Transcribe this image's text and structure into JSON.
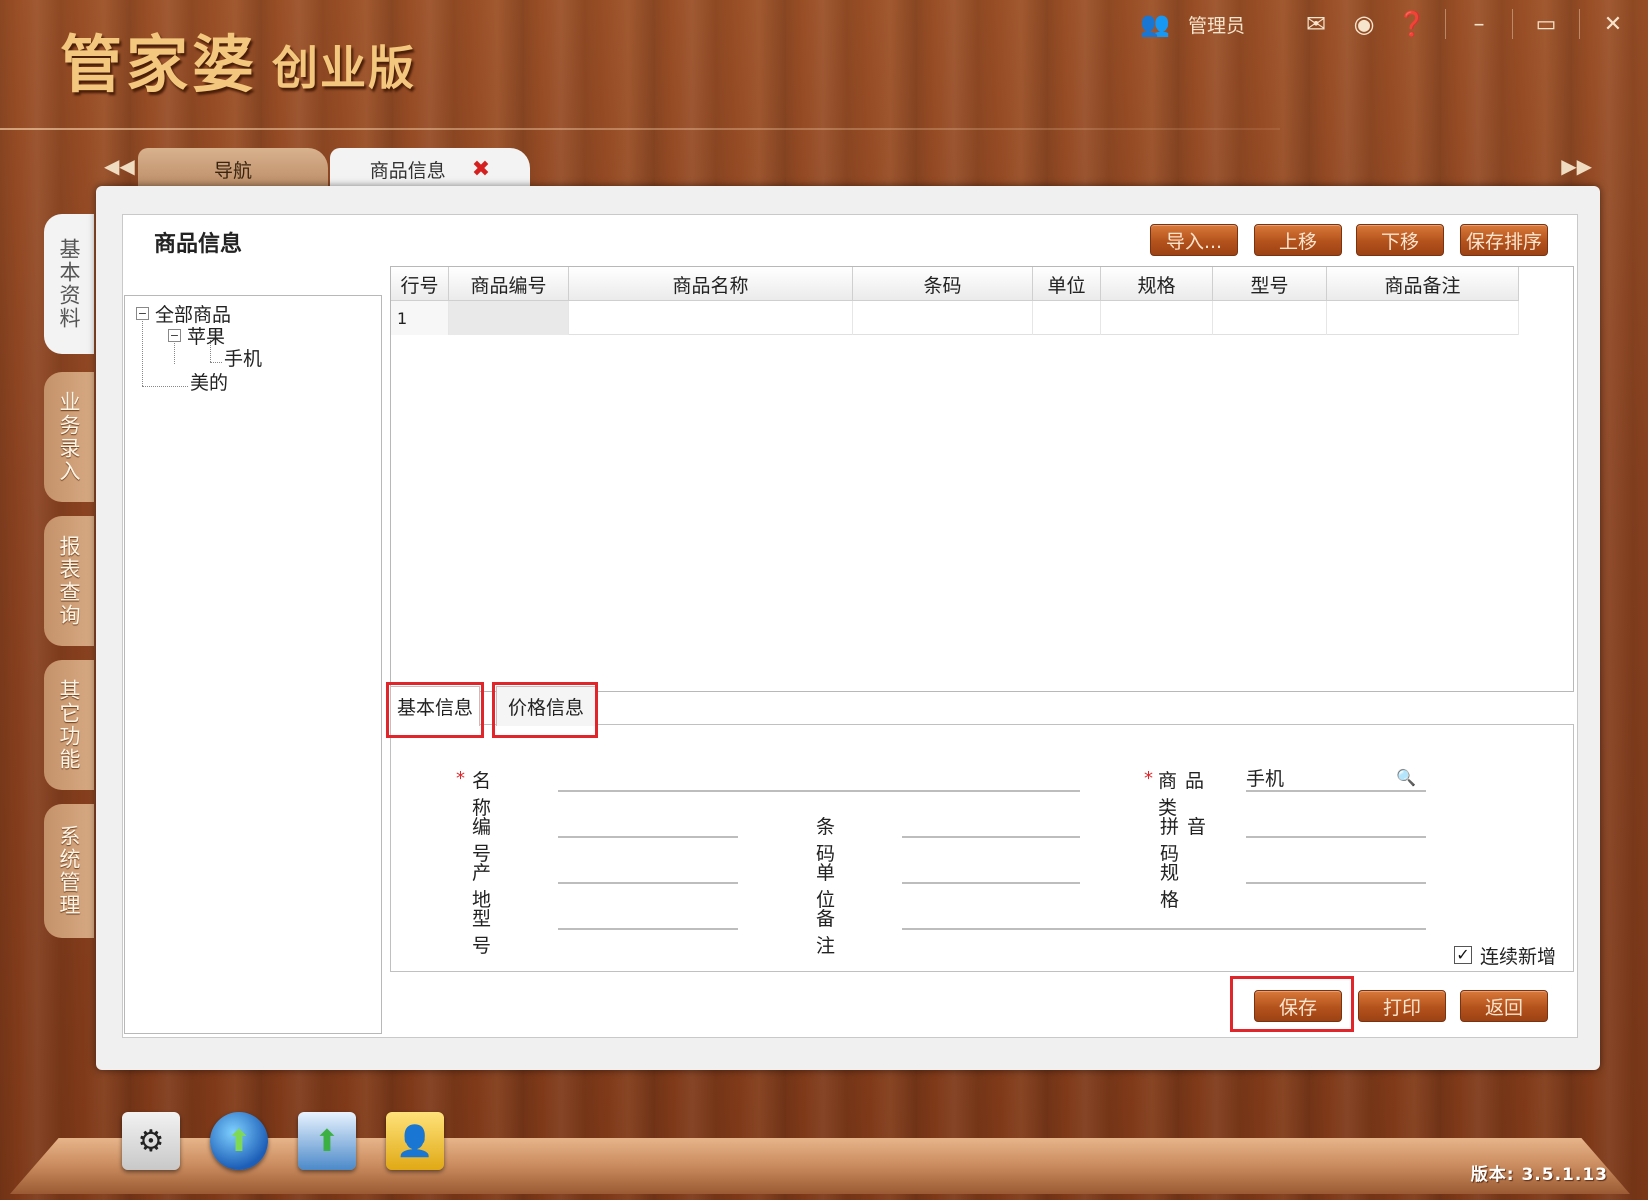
{
  "app": {
    "logo_main": "管家婆",
    "logo_sub": "创业版",
    "user": "管理员",
    "version": "版本: 3.5.1.13"
  },
  "tabs": [
    {
      "label": "导航"
    },
    {
      "label": "商品信息"
    }
  ],
  "side_tabs": [
    "基本资料",
    "业务录入",
    "报表查询",
    "其它功能",
    "系统管理"
  ],
  "page": {
    "title": "商品信息",
    "toolbar": {
      "import": "导入...",
      "move_up": "上移",
      "move_down": "下移",
      "save_order": "保存排序"
    }
  },
  "tree": {
    "root": "全部商品",
    "children": [
      {
        "label": "苹果",
        "children": [
          {
            "label": "手机"
          }
        ]
      },
      {
        "label": "美的"
      }
    ]
  },
  "grid": {
    "columns": [
      "行号",
      "商品编号",
      "商品名称",
      "条码",
      "单位",
      "规格",
      "型号",
      "商品备注"
    ],
    "rows": [
      [
        "1",
        "",
        "",
        "",
        "",
        "",
        "",
        ""
      ]
    ]
  },
  "form": {
    "tabs": [
      "基本信息",
      "价格信息"
    ],
    "labels": {
      "name": "名称",
      "category": "商品类",
      "code": "编号",
      "barcode": "条码",
      "pinyin": "拼音码",
      "origin": "产地",
      "unit": "单位",
      "spec": "规格",
      "model": "型号",
      "remark": "备注"
    },
    "values": {
      "category": "手机"
    },
    "continue_add": "连续新增",
    "continue_add_checked": true
  },
  "actions": {
    "save": "保存",
    "print": "打印",
    "back": "返回"
  }
}
